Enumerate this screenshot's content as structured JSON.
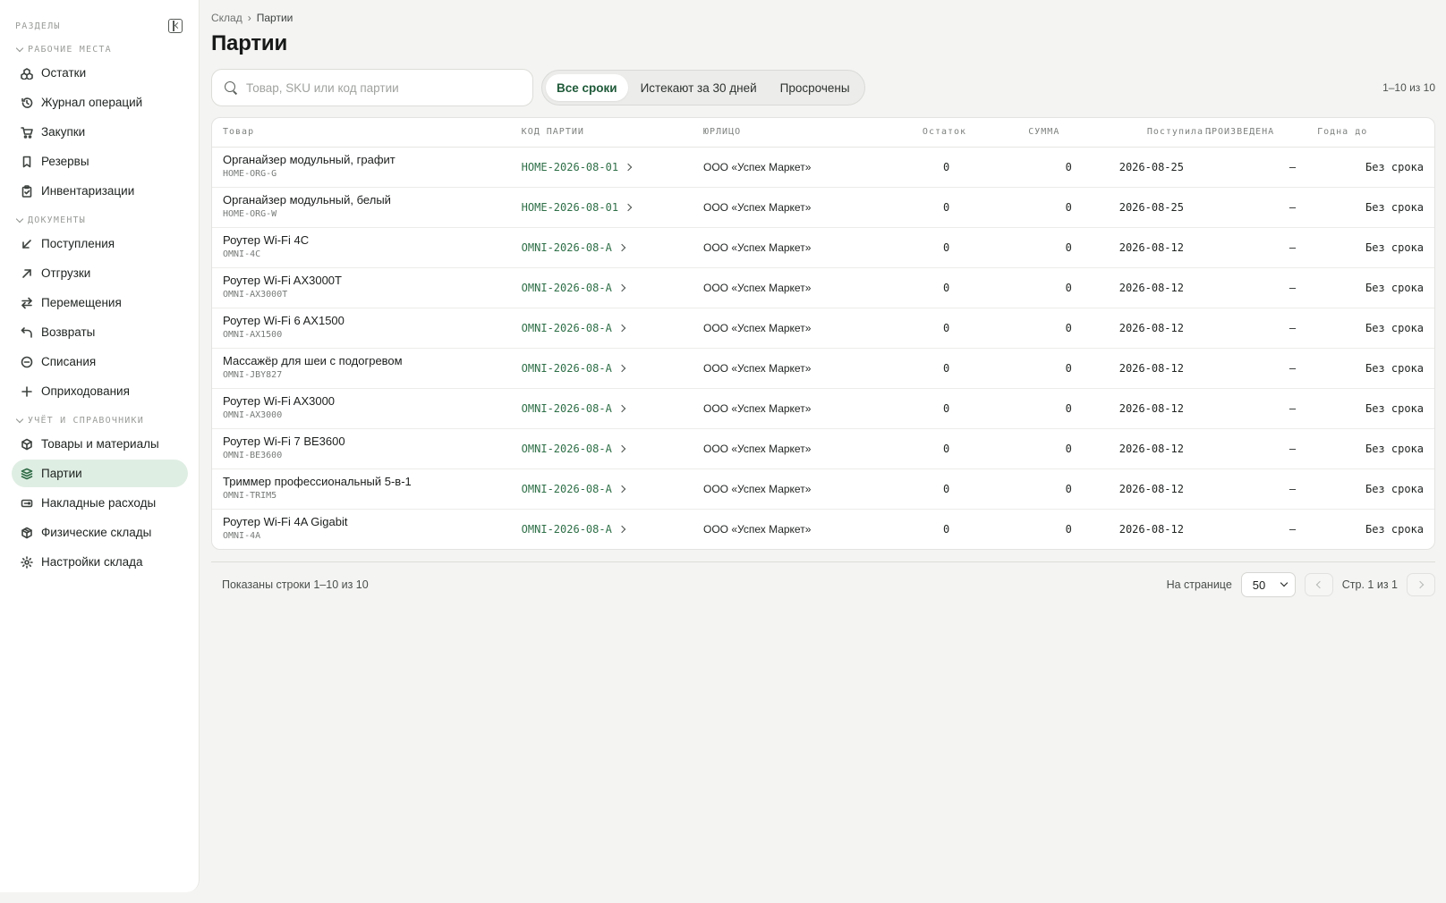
{
  "sidebar": {
    "caption": "РАЗДЕЛЫ",
    "groups": [
      {
        "title": "РАБОЧИЕ МЕСТА",
        "items": [
          {
            "label": "Остатки",
            "icon": "boxes-icon"
          },
          {
            "label": "Журнал операций",
            "icon": "history-icon"
          },
          {
            "label": "Закупки",
            "icon": "cart-icon"
          },
          {
            "label": "Резервы",
            "icon": "bookmark-icon"
          },
          {
            "label": "Инвентаризации",
            "icon": "clipboard-check-icon"
          }
        ]
      },
      {
        "title": "ДОКУМЕНТЫ",
        "items": [
          {
            "label": "Поступления",
            "icon": "arrow-down-left-icon"
          },
          {
            "label": "Отгрузки",
            "icon": "arrow-up-right-icon"
          },
          {
            "label": "Перемещения",
            "icon": "swap-icon"
          },
          {
            "label": "Возвраты",
            "icon": "undo-icon"
          },
          {
            "label": "Списания",
            "icon": "minus-circle-icon"
          },
          {
            "label": "Оприходования",
            "icon": "plus-icon"
          }
        ]
      },
      {
        "title": "УЧЁТ И СПРАВОЧНИКИ",
        "items": [
          {
            "label": "Товары и материалы",
            "icon": "package-icon"
          },
          {
            "label": "Партии",
            "icon": "layers-icon",
            "active": true
          },
          {
            "label": "Накладные расходы",
            "icon": "receipt-icon"
          },
          {
            "label": "Физические склады",
            "icon": "warehouse-icon"
          },
          {
            "label": "Настройки склада",
            "icon": "gear-icon"
          }
        ]
      }
    ]
  },
  "breadcrumb": {
    "root": "Склад",
    "separator": "›",
    "current": "Партии"
  },
  "page_title": "Партии",
  "search": {
    "placeholder": "Товар, SKU или код партии",
    "value": ""
  },
  "filters": [
    {
      "label": "Все сроки",
      "active": true
    },
    {
      "label": "Истекают за 30 дней",
      "active": false
    },
    {
      "label": "Просрочены",
      "active": false
    }
  ],
  "range_count": "1–10 из 10",
  "table": {
    "columns": [
      "Товар",
      "КОД ПАРТИИ",
      "ЮРЛИЦО",
      "Остаток",
      "СУММА",
      "Поступила",
      "ПРОИЗВЕДЕНА",
      "Годна до"
    ],
    "sort_indicator": "↓",
    "rows": [
      {
        "name": "Органайзер модульный, графит",
        "sku": "HOME-ORG-G",
        "batch": "HOME-2026-08-01",
        "entity": "ООО «Успех Маркет»",
        "stock": "0",
        "sum": "0",
        "received": "2026-08-25",
        "produced": "—",
        "expires": "Без срока"
      },
      {
        "name": "Органайзер модульный, белый",
        "sku": "HOME-ORG-W",
        "batch": "HOME-2026-08-01",
        "entity": "ООО «Успех Маркет»",
        "stock": "0",
        "sum": "0",
        "received": "2026-08-25",
        "produced": "—",
        "expires": "Без срока"
      },
      {
        "name": "Роутер Wi-Fi 4C",
        "sku": "OMNI-4C",
        "batch": "OMNI-2026-08-A",
        "entity": "ООО «Успех Маркет»",
        "stock": "0",
        "sum": "0",
        "received": "2026-08-12",
        "produced": "—",
        "expires": "Без срока"
      },
      {
        "name": "Роутер Wi-Fi AX3000T",
        "sku": "OMNI-AX3000T",
        "batch": "OMNI-2026-08-A",
        "entity": "ООО «Успех Маркет»",
        "stock": "0",
        "sum": "0",
        "received": "2026-08-12",
        "produced": "—",
        "expires": "Без срока"
      },
      {
        "name": "Роутер Wi-Fi 6 AX1500",
        "sku": "OMNI-AX1500",
        "batch": "OMNI-2026-08-A",
        "entity": "ООО «Успех Маркет»",
        "stock": "0",
        "sum": "0",
        "received": "2026-08-12",
        "produced": "—",
        "expires": "Без срока"
      },
      {
        "name": "Массажёр для шеи с подогревом",
        "sku": "OMNI-JBY827",
        "batch": "OMNI-2026-08-A",
        "entity": "ООО «Успех Маркет»",
        "stock": "0",
        "sum": "0",
        "received": "2026-08-12",
        "produced": "—",
        "expires": "Без срока"
      },
      {
        "name": "Роутер Wi-Fi AX3000",
        "sku": "OMNI-AX3000",
        "batch": "OMNI-2026-08-A",
        "entity": "ООО «Успех Маркет»",
        "stock": "0",
        "sum": "0",
        "received": "2026-08-12",
        "produced": "—",
        "expires": "Без срока"
      },
      {
        "name": "Роутер Wi-Fi 7 BE3600",
        "sku": "OMNI-BE3600",
        "batch": "OMNI-2026-08-A",
        "entity": "ООО «Успех Маркет»",
        "stock": "0",
        "sum": "0",
        "received": "2026-08-12",
        "produced": "—",
        "expires": "Без срока"
      },
      {
        "name": "Триммер профессиональный 5-в-1",
        "sku": "OMNI-TRIM5",
        "batch": "OMNI-2026-08-A",
        "entity": "ООО «Успех Маркет»",
        "stock": "0",
        "sum": "0",
        "received": "2026-08-12",
        "produced": "—",
        "expires": "Без срока"
      },
      {
        "name": "Роутер Wi-Fi 4A Gigabit",
        "sku": "OMNI-4A",
        "batch": "OMNI-2026-08-A",
        "entity": "ООО «Успех Маркет»",
        "stock": "0",
        "sum": "0",
        "received": "2026-08-12",
        "produced": "—",
        "expires": "Без срока"
      }
    ]
  },
  "footer": {
    "shown": "Показаны строки 1–10 из 10",
    "per_page_label": "На странице",
    "per_page_value": "50",
    "page_label": "Стр. 1 из 1"
  },
  "colors": {
    "accent": "#2e6f47",
    "active_bg": "#dfeee3",
    "page_bg": "#f4f4f3"
  }
}
